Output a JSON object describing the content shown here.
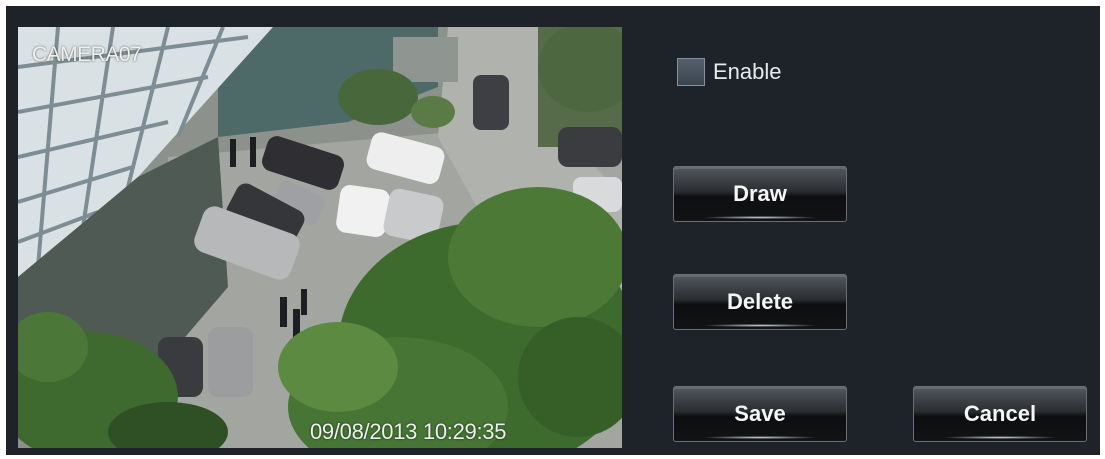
{
  "camera": {
    "name": "CAMERA07",
    "timestamp": "09/08/2013 10:29:35"
  },
  "enable": {
    "label": "Enable",
    "checked": false
  },
  "buttons": {
    "draw": "Draw",
    "delete": "Delete",
    "save": "Save",
    "cancel": "Cancel"
  },
  "colors": {
    "panel_background": "#1e2229",
    "button_gradient_top": "#54585e",
    "button_gradient_bottom": "#0d0e10",
    "text": "#f5f5f5"
  }
}
